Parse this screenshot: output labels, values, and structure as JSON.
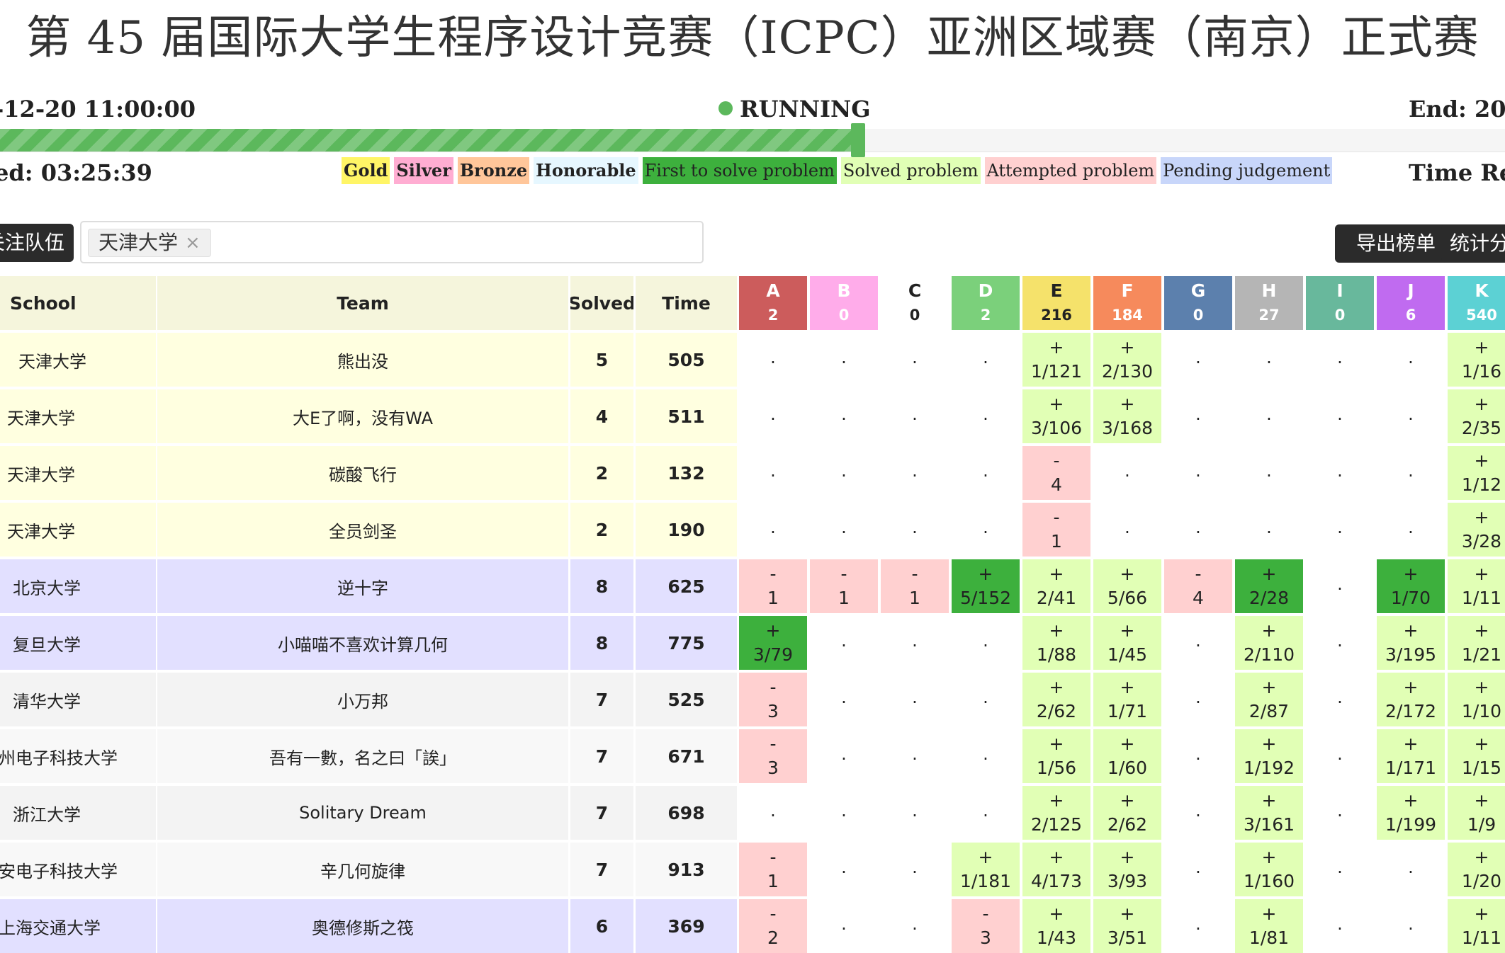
{
  "title": "第 45 届国际大学生程序设计竞赛（ICPC）亚洲区域赛（南京）正式赛",
  "start_time": "-12-20 11:00:00",
  "status": "RUNNING",
  "end_time": "End: 20",
  "elapsed": "ed: 03:25:39",
  "remaining": "Time Re",
  "progress_fraction": 0.57,
  "legend": [
    {
      "label": "Gold",
      "color": "#fff566"
    },
    {
      "label": "Silver",
      "color": "#ffadd2"
    },
    {
      "label": "Bronze",
      "color": "#ffc69a"
    },
    {
      "label": "Honorable",
      "color": "#e6f7ff"
    },
    {
      "label": "First to solve problem",
      "color": "#3db03d"
    },
    {
      "label": "Solved problem",
      "color": "#e1ffb5"
    },
    {
      "label": "Attempted problem",
      "color": "#ffd0d0"
    },
    {
      "label": "Pending judgement",
      "color": "#c8d6fa"
    }
  ],
  "filter": {
    "label": "关注队伍",
    "selected_tag": "天津大学",
    "remove_icon": "×"
  },
  "buttons": {
    "export": "导出榜单",
    "stats": "统计分"
  },
  "columns": {
    "school": "School",
    "team": "Team",
    "solved": "Solved",
    "time": "Time"
  },
  "problems": [
    {
      "letter": "A",
      "count": "2",
      "color": "#cc5c5c"
    },
    {
      "letter": "B",
      "count": "0",
      "color": "#ffacea"
    },
    {
      "letter": "C",
      "count": "0",
      "color": "#ffffff"
    },
    {
      "letter": "D",
      "count": "2",
      "color": "#7bd07b"
    },
    {
      "letter": "E",
      "count": "216",
      "color": "#f5e26b"
    },
    {
      "letter": "F",
      "count": "184",
      "color": "#f68a5c"
    },
    {
      "letter": "G",
      "count": "0",
      "color": "#5c80ad"
    },
    {
      "letter": "H",
      "count": "27",
      "color": "#b5b5b5"
    },
    {
      "letter": "I",
      "count": "0",
      "color": "#68b89c"
    },
    {
      "letter": "J",
      "count": "6",
      "color": "#c06bf0"
    },
    {
      "letter": "K",
      "count": "540",
      "color": "#5cd1d4"
    }
  ],
  "colors": {
    "followed_bg": "#ffffe0",
    "gold_bg": "#e2e0ff",
    "other_bg": "#f3f3f3",
    "other_bg_alt": "#f8f8f8",
    "header_bg": "#f5f5dc",
    "first": "#3db03d",
    "solved": "#e1ffb5",
    "attempted": "#ffd0d0"
  },
  "rows": [
    {
      "school": "天津大学",
      "team": "熊出没",
      "solved": "5",
      "time": "505",
      "band": "followed",
      "results": [
        {
          "s": "none"
        },
        {
          "s": "none"
        },
        {
          "s": "none"
        },
        {
          "s": "none"
        },
        {
          "s": "solved",
          "top": "+",
          "bottom": "1/121"
        },
        {
          "s": "solved",
          "top": "+",
          "bottom": "2/130"
        },
        {
          "s": "none"
        },
        {
          "s": "none"
        },
        {
          "s": "none"
        },
        {
          "s": "none"
        },
        {
          "s": "solved",
          "top": "+",
          "bottom": "1/16"
        }
      ]
    },
    {
      "school": "天津大学",
      "team": "大E了啊，没有WA",
      "solved": "4",
      "time": "511",
      "band": "followed",
      "results": [
        {
          "s": "none"
        },
        {
          "s": "none"
        },
        {
          "s": "none"
        },
        {
          "s": "none"
        },
        {
          "s": "solved",
          "top": "+",
          "bottom": "3/106"
        },
        {
          "s": "solved",
          "top": "+",
          "bottom": "3/168"
        },
        {
          "s": "none"
        },
        {
          "s": "none"
        },
        {
          "s": "none"
        },
        {
          "s": "none"
        },
        {
          "s": "solved",
          "top": "+",
          "bottom": "2/35"
        }
      ]
    },
    {
      "school": "天津大学",
      "team": "碳酸飞行",
      "solved": "2",
      "time": "132",
      "band": "followed",
      "results": [
        {
          "s": "none"
        },
        {
          "s": "none"
        },
        {
          "s": "none"
        },
        {
          "s": "none"
        },
        {
          "s": "attempted",
          "top": "-",
          "bottom": "4"
        },
        {
          "s": "none"
        },
        {
          "s": "none"
        },
        {
          "s": "none"
        },
        {
          "s": "none"
        },
        {
          "s": "none"
        },
        {
          "s": "solved",
          "top": "+",
          "bottom": "1/12"
        }
      ]
    },
    {
      "school": "天津大学",
      "team": "全员剑圣",
      "solved": "2",
      "time": "190",
      "band": "followed",
      "results": [
        {
          "s": "none"
        },
        {
          "s": "none"
        },
        {
          "s": "none"
        },
        {
          "s": "none"
        },
        {
          "s": "attempted",
          "top": "-",
          "bottom": "1"
        },
        {
          "s": "none"
        },
        {
          "s": "none"
        },
        {
          "s": "none"
        },
        {
          "s": "none"
        },
        {
          "s": "none"
        },
        {
          "s": "solved",
          "top": "+",
          "bottom": "3/28"
        }
      ]
    },
    {
      "school": "北京大学",
      "team": "逆十字",
      "solved": "8",
      "time": "625",
      "band": "gold",
      "results": [
        {
          "s": "attempted",
          "top": "-",
          "bottom": "1"
        },
        {
          "s": "attempted",
          "top": "-",
          "bottom": "1"
        },
        {
          "s": "attempted",
          "top": "-",
          "bottom": "1"
        },
        {
          "s": "first",
          "top": "+",
          "bottom": "5/152"
        },
        {
          "s": "solved",
          "top": "+",
          "bottom": "2/41"
        },
        {
          "s": "solved",
          "top": "+",
          "bottom": "5/66"
        },
        {
          "s": "attempted",
          "top": "-",
          "bottom": "4"
        },
        {
          "s": "first",
          "top": "+",
          "bottom": "2/28"
        },
        {
          "s": "none"
        },
        {
          "s": "first",
          "top": "+",
          "bottom": "1/70"
        },
        {
          "s": "solved",
          "top": "+",
          "bottom": "1/11"
        }
      ]
    },
    {
      "school": "复旦大学",
      "team": "小喵喵不喜欢计算几何",
      "solved": "8",
      "time": "775",
      "band": "gold",
      "results": [
        {
          "s": "first",
          "top": "+",
          "bottom": "3/79"
        },
        {
          "s": "none"
        },
        {
          "s": "none"
        },
        {
          "s": "none"
        },
        {
          "s": "solved",
          "top": "+",
          "bottom": "1/88"
        },
        {
          "s": "solved",
          "top": "+",
          "bottom": "1/45"
        },
        {
          "s": "none"
        },
        {
          "s": "solved",
          "top": "+",
          "bottom": "2/110"
        },
        {
          "s": "none"
        },
        {
          "s": "solved",
          "top": "+",
          "bottom": "3/195"
        },
        {
          "s": "solved",
          "top": "+",
          "bottom": "1/21"
        }
      ]
    },
    {
      "school": "清华大学",
      "team": "小万邦",
      "solved": "7",
      "time": "525",
      "band": "other",
      "results": [
        {
          "s": "attempted",
          "top": "-",
          "bottom": "3"
        },
        {
          "s": "none"
        },
        {
          "s": "none"
        },
        {
          "s": "none"
        },
        {
          "s": "solved",
          "top": "+",
          "bottom": "2/62"
        },
        {
          "s": "solved",
          "top": "+",
          "bottom": "1/71"
        },
        {
          "s": "none"
        },
        {
          "s": "solved",
          "top": "+",
          "bottom": "2/87"
        },
        {
          "s": "none"
        },
        {
          "s": "solved",
          "top": "+",
          "bottom": "2/172"
        },
        {
          "s": "solved",
          "top": "+",
          "bottom": "1/10"
        }
      ]
    },
    {
      "school": "州电子科技大学",
      "team": "吾有一數，名之曰「誒」",
      "solved": "7",
      "time": "671",
      "band": "other_alt",
      "results": [
        {
          "s": "attempted",
          "top": "-",
          "bottom": "3"
        },
        {
          "s": "none"
        },
        {
          "s": "none"
        },
        {
          "s": "none"
        },
        {
          "s": "solved",
          "top": "+",
          "bottom": "1/56"
        },
        {
          "s": "solved",
          "top": "+",
          "bottom": "1/60"
        },
        {
          "s": "none"
        },
        {
          "s": "solved",
          "top": "+",
          "bottom": "1/192"
        },
        {
          "s": "none"
        },
        {
          "s": "solved",
          "top": "+",
          "bottom": "1/171"
        },
        {
          "s": "solved",
          "top": "+",
          "bottom": "1/15"
        }
      ]
    },
    {
      "school": "浙江大学",
      "team": "Solitary Dream",
      "solved": "7",
      "time": "698",
      "band": "other",
      "results": [
        {
          "s": "none"
        },
        {
          "s": "none"
        },
        {
          "s": "none"
        },
        {
          "s": "none"
        },
        {
          "s": "solved",
          "top": "+",
          "bottom": "2/125"
        },
        {
          "s": "solved",
          "top": "+",
          "bottom": "2/62"
        },
        {
          "s": "none"
        },
        {
          "s": "solved",
          "top": "+",
          "bottom": "3/161"
        },
        {
          "s": "none"
        },
        {
          "s": "solved",
          "top": "+",
          "bottom": "1/199"
        },
        {
          "s": "solved",
          "top": "+",
          "bottom": "1/9"
        }
      ]
    },
    {
      "school": "安电子科技大学",
      "team": "辛几何旋律",
      "solved": "7",
      "time": "913",
      "band": "other_alt",
      "results": [
        {
          "s": "attempted",
          "top": "-",
          "bottom": "1"
        },
        {
          "s": "none"
        },
        {
          "s": "none"
        },
        {
          "s": "solved",
          "top": "+",
          "bottom": "1/181"
        },
        {
          "s": "solved",
          "top": "+",
          "bottom": "4/173"
        },
        {
          "s": "solved",
          "top": "+",
          "bottom": "3/93"
        },
        {
          "s": "none"
        },
        {
          "s": "solved",
          "top": "+",
          "bottom": "1/160"
        },
        {
          "s": "none"
        },
        {
          "s": "none"
        },
        {
          "s": "solved",
          "top": "+",
          "bottom": "1/20"
        }
      ]
    },
    {
      "school": "上海交通大学",
      "team": "奥德修斯之筏",
      "solved": "6",
      "time": "369",
      "band": "gold",
      "results": [
        {
          "s": "attempted",
          "top": "-",
          "bottom": "2"
        },
        {
          "s": "none"
        },
        {
          "s": "none"
        },
        {
          "s": "attempted",
          "top": "-",
          "bottom": "3"
        },
        {
          "s": "solved",
          "top": "+",
          "bottom": "1/43"
        },
        {
          "s": "solved",
          "top": "+",
          "bottom": "3/51"
        },
        {
          "s": "none"
        },
        {
          "s": "solved",
          "top": "+",
          "bottom": "1/81"
        },
        {
          "s": "none"
        },
        {
          "s": "none"
        },
        {
          "s": "solved",
          "top": "+",
          "bottom": "1/11"
        }
      ]
    }
  ]
}
